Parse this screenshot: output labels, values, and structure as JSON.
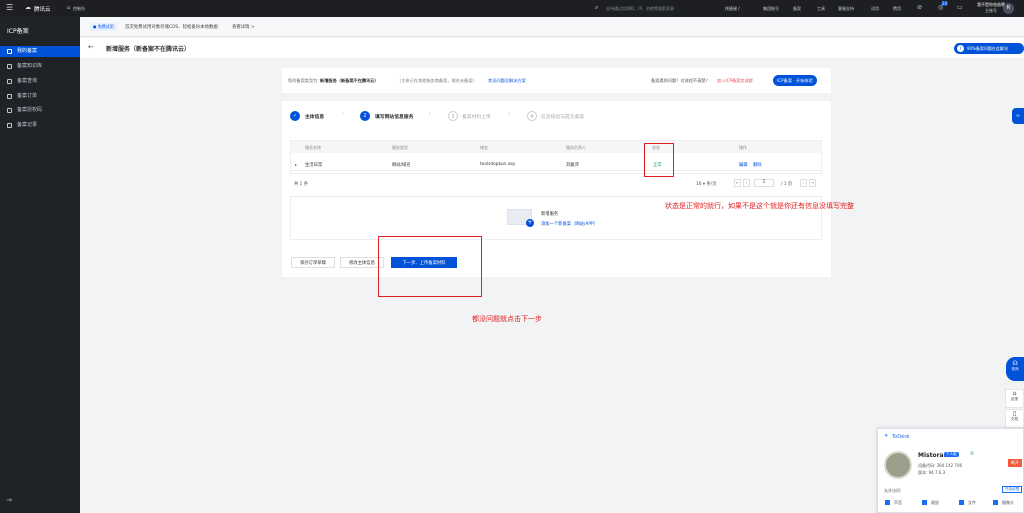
{
  "topbar": {
    "logo": "腾讯云",
    "console": "控制台",
    "search_placeholder": "支持通过实例ID、IP、名称等搜索资源",
    "shortcut": "快捷键 /",
    "links": [
      "集团账号",
      "备案",
      "工具",
      "客服支持",
      "试用",
      "费用"
    ],
    "badge": "24",
    "account_line1": "我不是你爸爸哦",
    "account_line2": "主账号",
    "avatar": "R"
  },
  "sidebar": {
    "title": "ICP备案",
    "items": [
      {
        "label": "我的备案",
        "active": true
      },
      {
        "label": "备案知识库",
        "active": false
      },
      {
        "label": "备案查询",
        "active": false
      },
      {
        "label": "备案订单",
        "active": false
      },
      {
        "label": "备案授权码",
        "active": false
      },
      {
        "label": "备案记录",
        "active": false
      }
    ]
  },
  "notice": {
    "tag": "● 免费试用",
    "text": "首次免费试用对象存储COS、轻松备份本地数据",
    "link": "查看详情 >"
  },
  "page": {
    "back": "←",
    "title": "新增服务（新备案不在腾讯云）",
    "help_button": "90%备案问题在此解决"
  },
  "info": {
    "prefix": "您的备案类型为：",
    "type": "新增服务（新备案不在腾讯云）",
    "desc": "（主体已在其他服务商备案，域名未备案）",
    "link": "常见问题及解决方案",
    "question": "备案遇到问题？对流程不清楚？",
    "join": "加入ICP备案交流群",
    "icp_btn": "ICP备案 · 开始体验"
  },
  "steps": [
    {
      "num": "✓",
      "label": "主体信息",
      "state": "done"
    },
    {
      "num": "2",
      "label": "填写网站信息服务",
      "state": "active"
    },
    {
      "num": "3",
      "label": "备案材料上传",
      "state": "todo"
    },
    {
      "num": "4",
      "label": "信息核验与提交备案",
      "state": "todo"
    }
  ],
  "table": {
    "headers": [
      "服务名称",
      "服务类型",
      "域名",
      "服务负责人",
      "状态",
      "操作"
    ],
    "rows": [
      {
        "name": "生活日常",
        "type": "网站/域名",
        "domain": "toolsdopkun.xsp",
        "owner": "刘雅萍",
        "status": "正常",
        "edit": "编辑",
        "delete": "删除"
      }
    ],
    "total": "共 1 条",
    "page_size": "10 ▾ 条/页",
    "page": "1",
    "page_total": "/ 1 页"
  },
  "add_service": {
    "title": "新增服务",
    "link": "添加一个新备案（网站/APP）"
  },
  "buttons": {
    "save_draft": "保存订单草稿",
    "edit_subject": "修改主体信息",
    "next": "下一步、上传备案材料"
  },
  "annotations": {
    "status_note": "状态是正常的就行，如果不是这个就是你还有信息没填写完整",
    "next_note": "都没问题就点击下一步"
  },
  "right_tools": {
    "consult": "咨询",
    "feedback": "反馈",
    "docs": "文档"
  },
  "todesk": {
    "brand": "ToDesk",
    "name": "Mistora.",
    "tag": "个人版",
    "device_code": "设备代码: 394 142 706",
    "version": "版本: 94.7.6.3",
    "btn": "断开",
    "allow_label": "允许访问:",
    "allow_btn": "开启权限",
    "options": [
      "声音",
      "键鼠",
      "文件",
      "摄像头"
    ]
  },
  "colors": {
    "brand": "#0052d9",
    "success": "#2ba471",
    "annotation": "#e02020"
  }
}
